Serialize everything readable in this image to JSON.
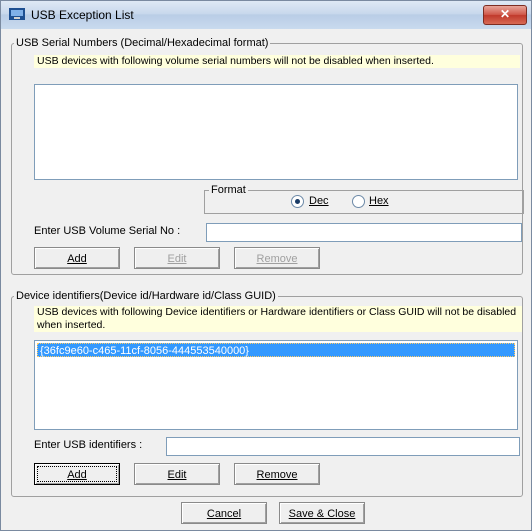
{
  "window": {
    "title": "USB Exception List",
    "close_label": "✕"
  },
  "serial_group": {
    "label": "USB Serial Numbers (Decimal/Hexadecimal format)",
    "description": "USB devices with following volume serial numbers will not be disabled when inserted.",
    "items": [],
    "format": {
      "label": "Format",
      "options": [
        {
          "label": "Dec",
          "selected": true
        },
        {
          "label": "Hex",
          "selected": false
        }
      ]
    },
    "input_label": "Enter USB Volume Serial No :",
    "input_value": "",
    "buttons": {
      "add": "Add",
      "edit": "Edit",
      "remove": "Remove"
    }
  },
  "device_group": {
    "label": "Device identifiers(Device id/Hardware id/Class GUID)",
    "description": "USB devices with following Device identifiers or Hardware identifiers or Class GUID will not be disabled when inserted.",
    "items": [
      "{36fc9e60-c465-11cf-8056-444553540000}"
    ],
    "input_label": "Enter USB identifiers :",
    "input_value": "",
    "buttons": {
      "add": "Add",
      "edit": "Edit",
      "remove": "Remove"
    }
  },
  "footer": {
    "cancel": "Cancel",
    "save_close": "Save & Close"
  },
  "colors": {
    "selection": "#3399ff",
    "description_bg": "#ffffdd",
    "close_button": "#c0392b"
  }
}
